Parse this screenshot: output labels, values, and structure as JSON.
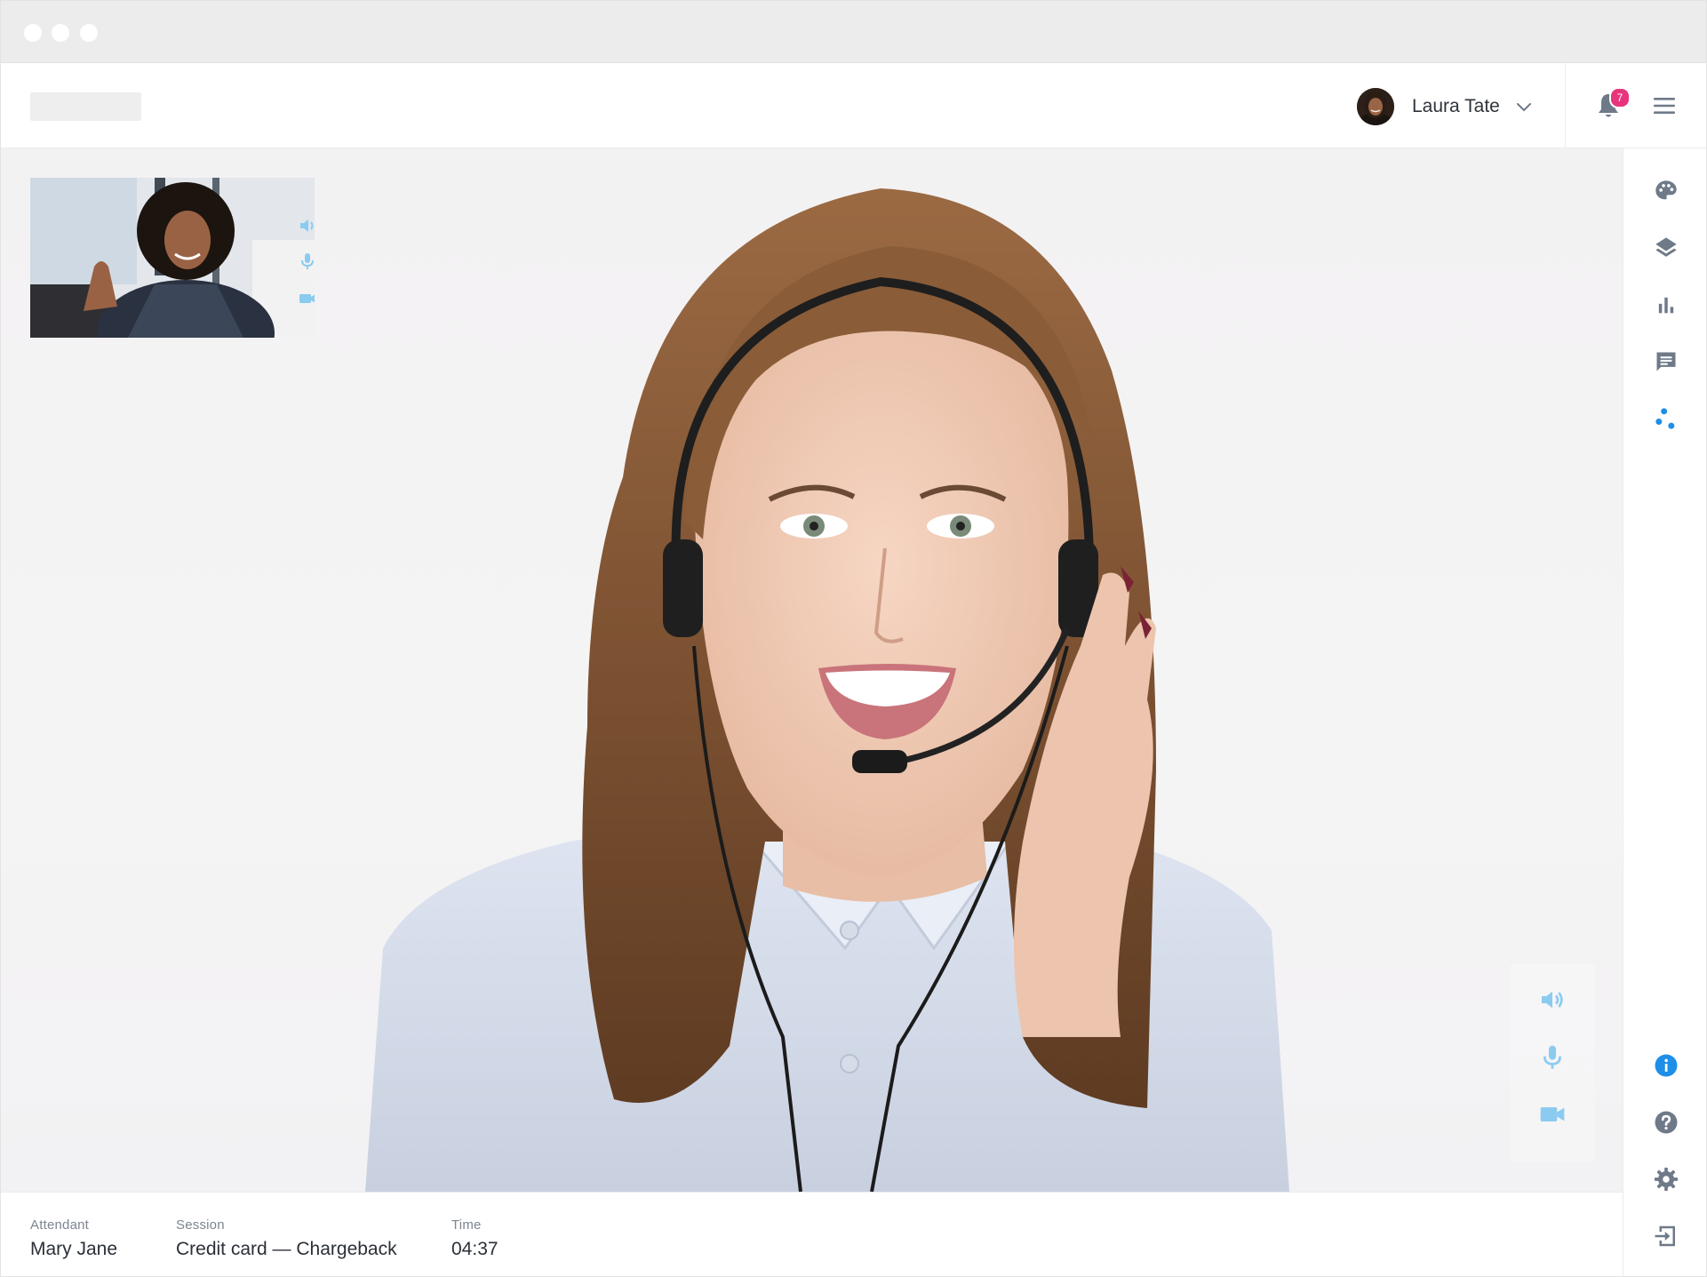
{
  "header": {
    "user_name": "Laura Tate",
    "notification_count": "7"
  },
  "footer": {
    "attendant_label": "Attendant",
    "attendant_value": "Mary Jane",
    "session_label": "Session",
    "session_value": "Credit card — Chargeback",
    "time_label": "Time",
    "time_value": "04:37"
  },
  "icons": {
    "sidebar_top": [
      "palette-icon",
      "layers-icon",
      "bar-chart-icon",
      "chat-icon",
      "nodes-icon"
    ],
    "sidebar_bottom": [
      "info-icon",
      "help-icon",
      "settings-icon",
      "logout-icon"
    ],
    "call_controls": [
      "speaker-icon",
      "microphone-icon",
      "camera-icon"
    ]
  },
  "colors": {
    "accent_blue": "#1d8fe8",
    "control_light_blue": "#8ccbf0",
    "badge_pink": "#e8347c",
    "icon_gray": "#6e7a88"
  }
}
